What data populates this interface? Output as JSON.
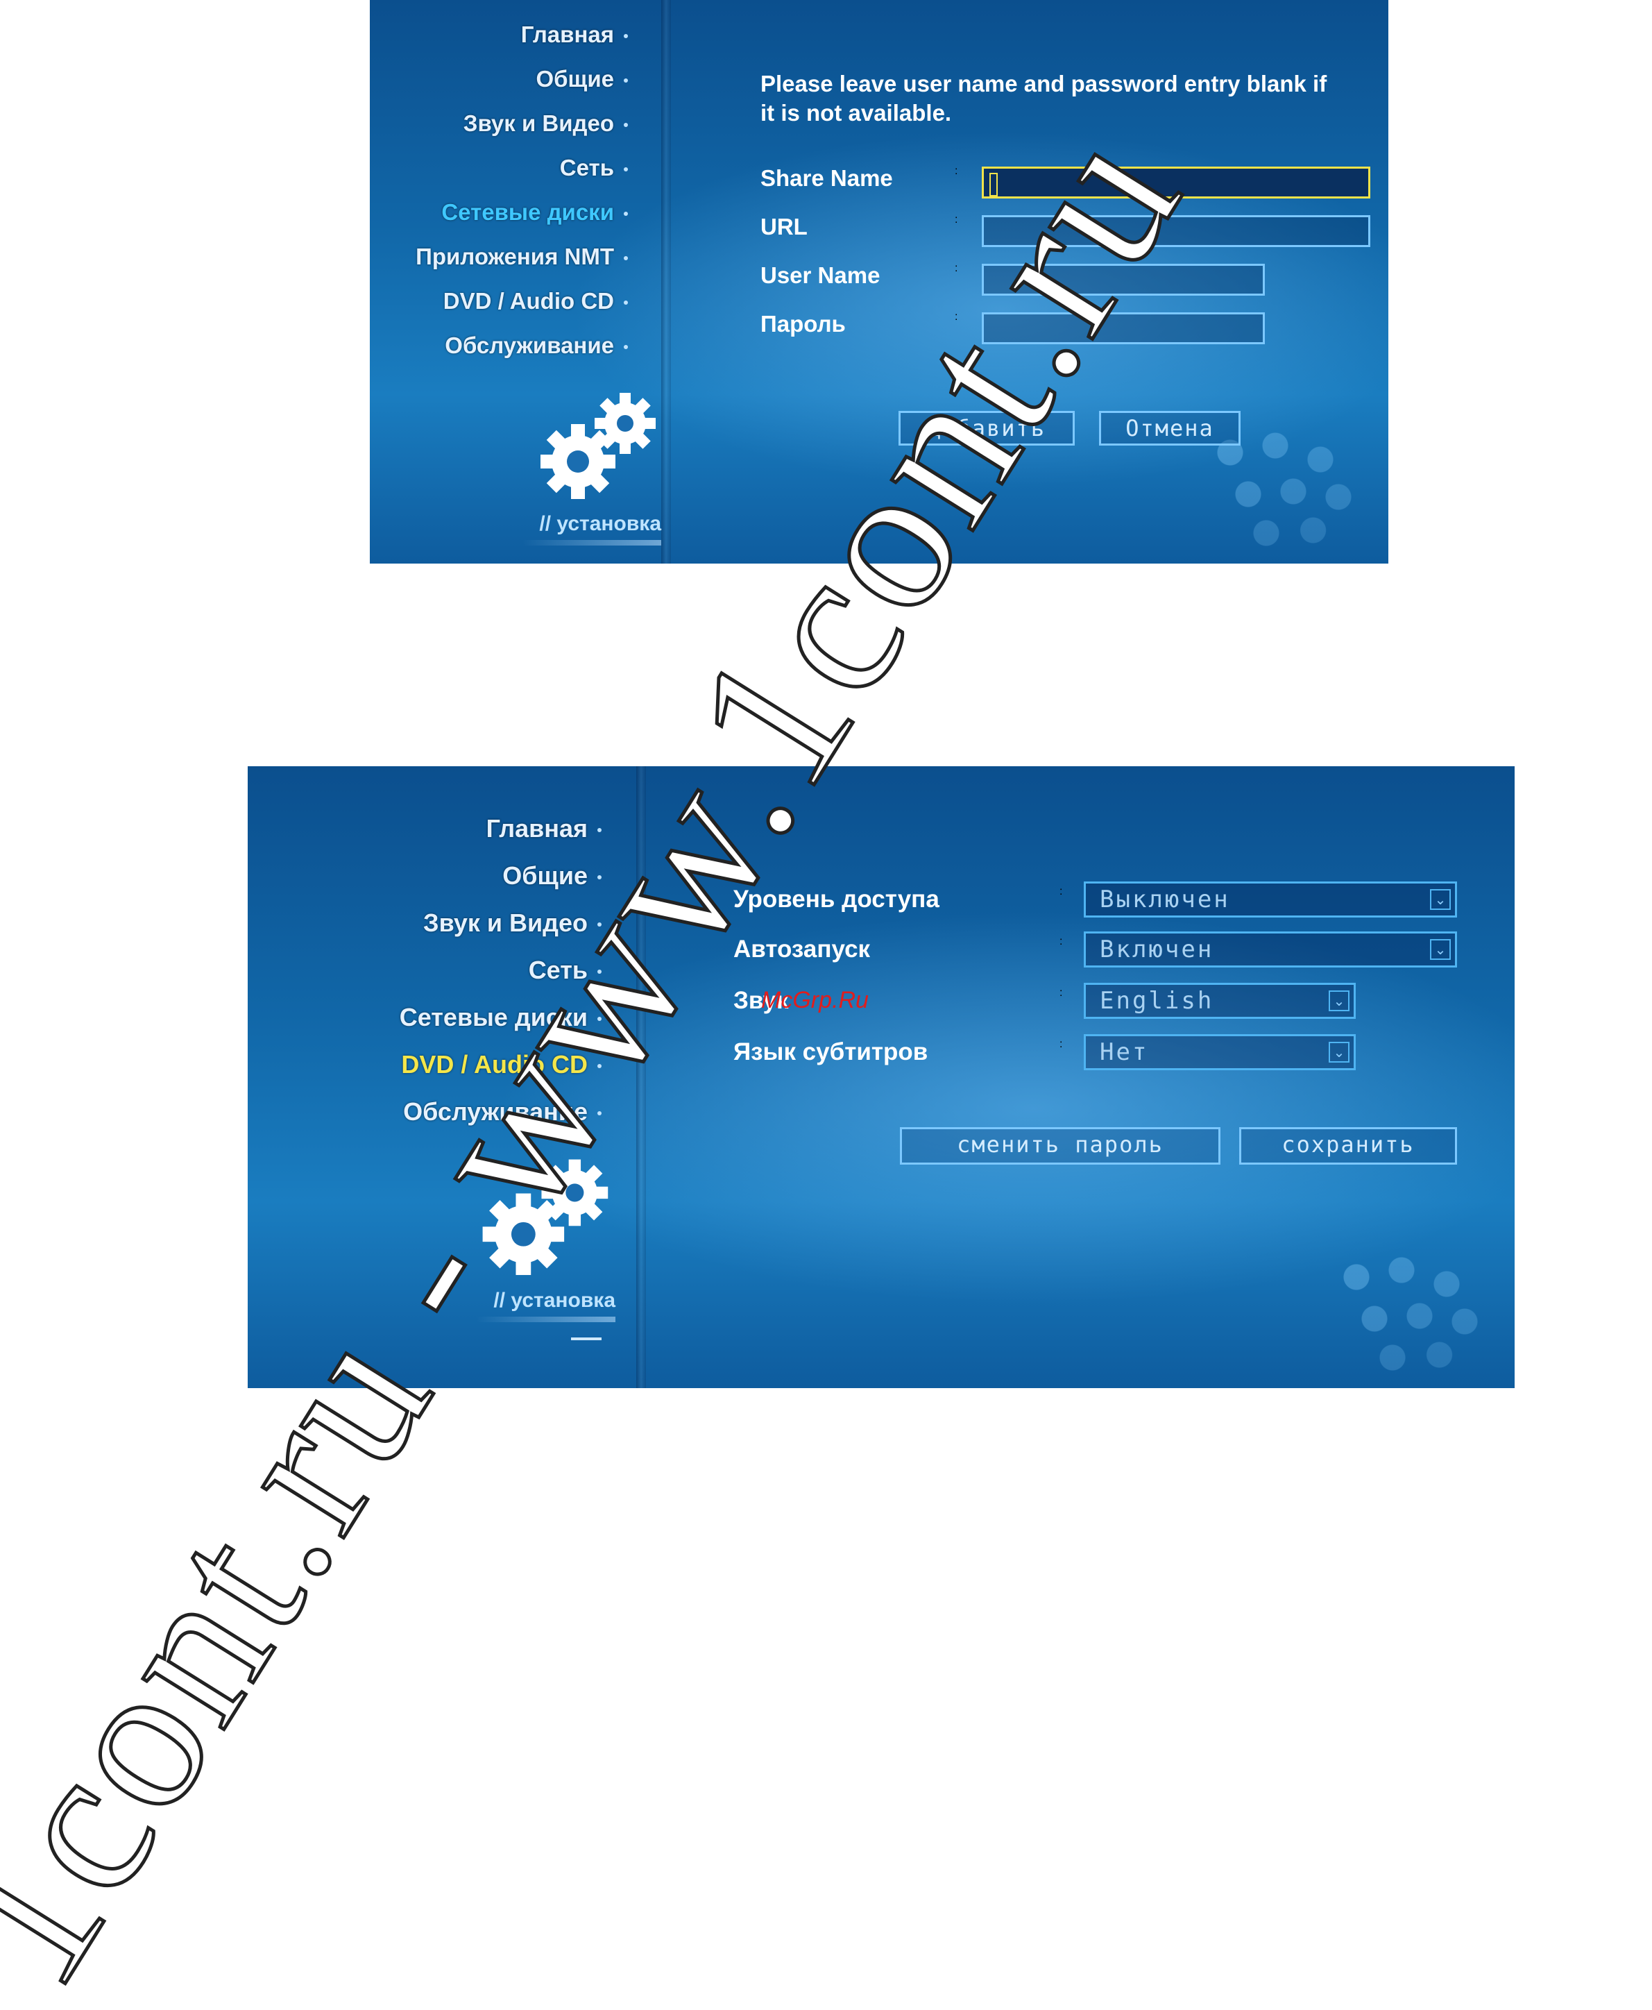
{
  "screen1": {
    "menu": [
      {
        "label": "Главная"
      },
      {
        "label": "Общие"
      },
      {
        "label": "Звук и Видео"
      },
      {
        "label": "Сеть"
      },
      {
        "label": "Сетевые диски"
      },
      {
        "label": "Приложения NMT"
      },
      {
        "label": "DVD / Audio CD"
      },
      {
        "label": "Обслуживание"
      }
    ],
    "active_index": 4,
    "section_label": "// установка",
    "info": "Please leave user name and password entry blank if it is not available.",
    "fields": [
      {
        "label": "Share Name",
        "value": ""
      },
      {
        "label": "URL",
        "value": ""
      },
      {
        "label": "User Name",
        "value": ""
      },
      {
        "label": "Пароль",
        "value": ""
      }
    ],
    "colon": ":",
    "buttons": {
      "add": "добавить",
      "cancel": "Отмена"
    }
  },
  "screen2": {
    "menu": [
      {
        "label": "Главная"
      },
      {
        "label": "Общие"
      },
      {
        "label": "Звук и Видео"
      },
      {
        "label": "Сеть"
      },
      {
        "label": "Сетевые диски"
      },
      {
        "label": "DVD / Audio CD"
      },
      {
        "label": "Обслуживание"
      }
    ],
    "active_index": 5,
    "section_label": "// установка",
    "settings": [
      {
        "label": "Уровень доступа",
        "value": "Выключен"
      },
      {
        "label": "Автозапуск",
        "value": "Включен"
      },
      {
        "label": "Звук",
        "value": "English"
      },
      {
        "label": "Язык субтитров",
        "value": "Нет"
      }
    ],
    "colon": ":",
    "buttons": {
      "change_password": "сменить пароль",
      "save": "сохранить"
    }
  },
  "watermark_label": "McGrp.Ru",
  "watermark_text": "1cont.ru - www.1cont.ru",
  "colors": {
    "accent_cyan": "#3fc8ff",
    "accent_yellow": "#f4e64a",
    "focus_border": "#f2e34a",
    "watermark_red": "#e11d1d"
  }
}
